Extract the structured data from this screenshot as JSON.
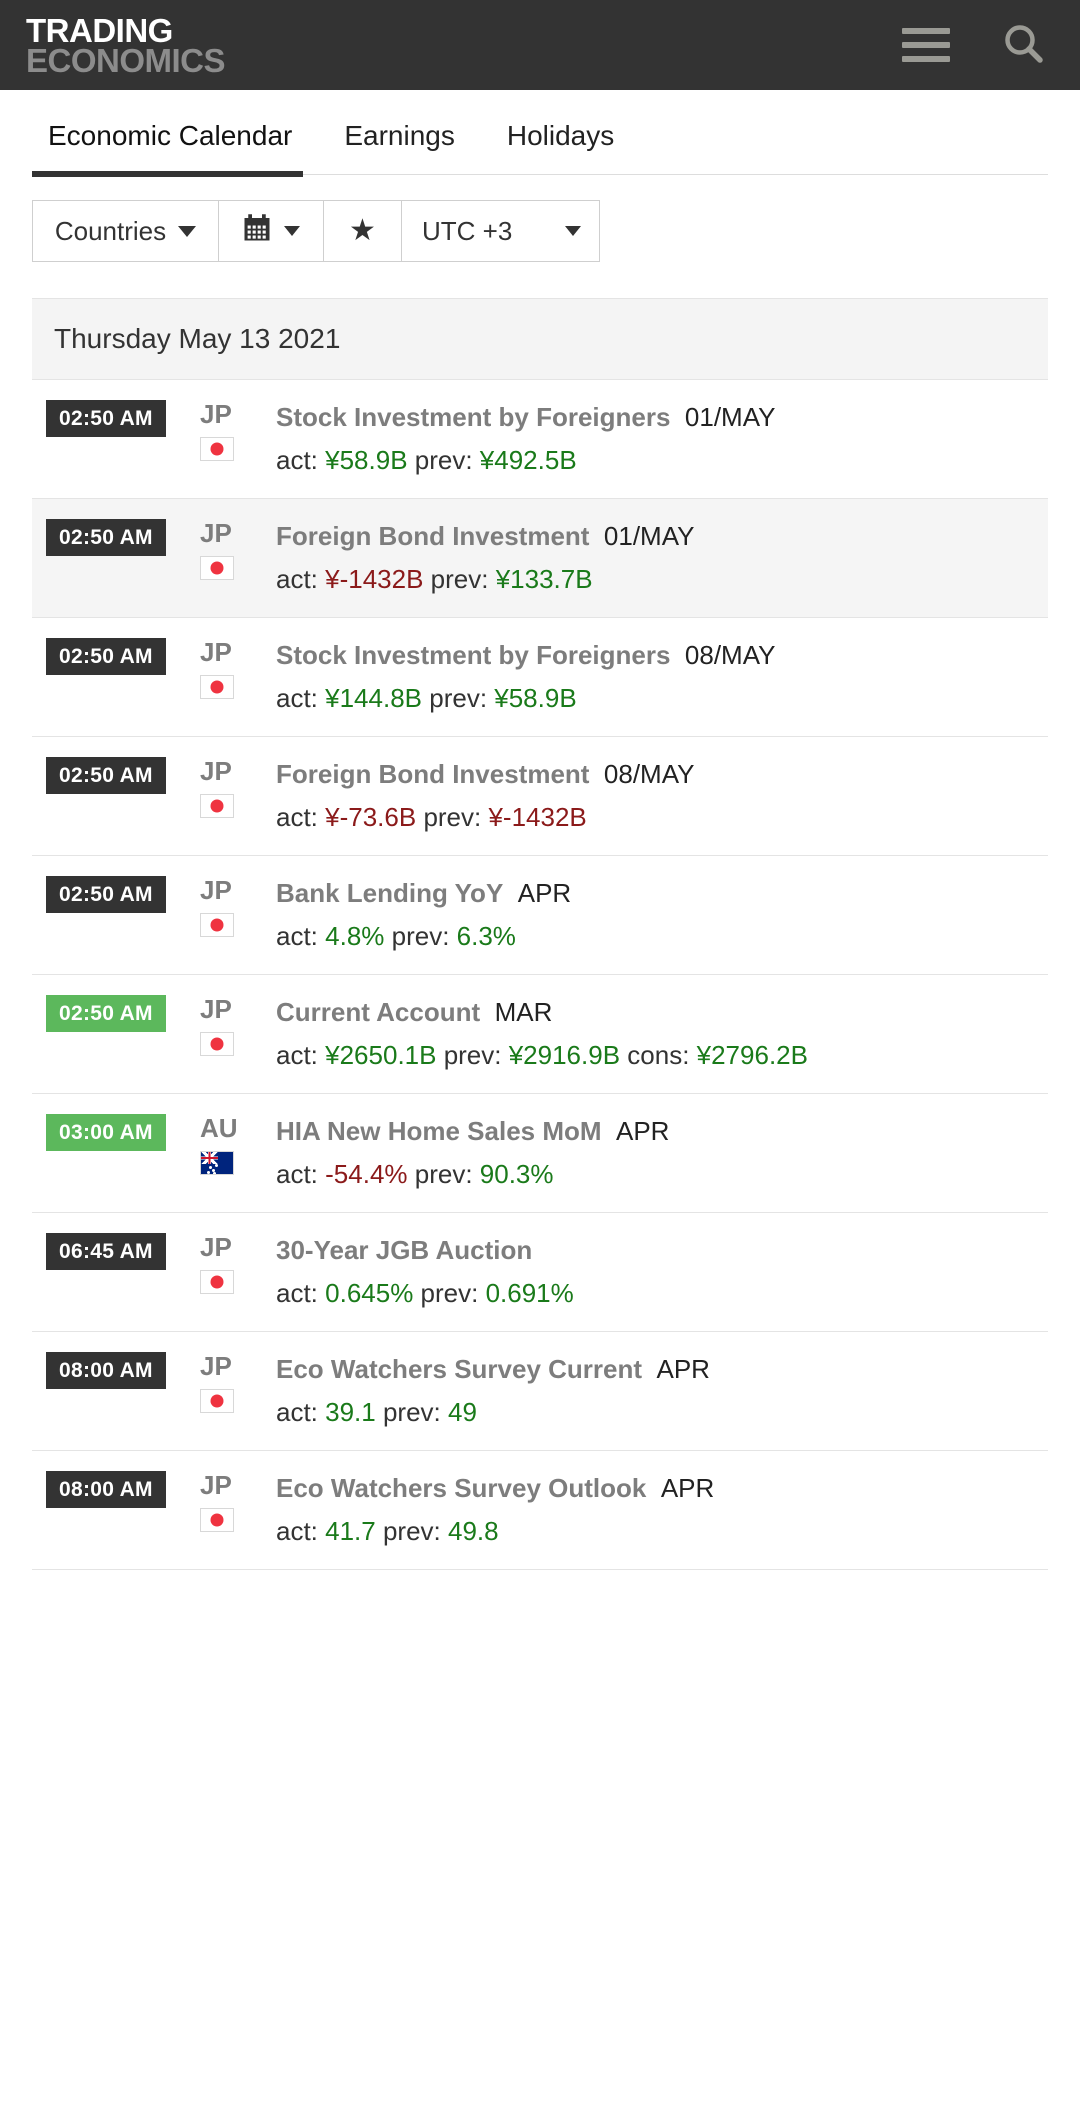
{
  "header": {
    "brand_top": "TRADING",
    "brand_bottom": "ECONOMICS",
    "menu_icon": "hamburger-icon",
    "search_icon": "search-icon",
    "background_color": "#333333"
  },
  "tabs": [
    {
      "label": "Economic Calendar",
      "active": true
    },
    {
      "label": "Earnings",
      "active": false
    },
    {
      "label": "Holidays",
      "active": false
    }
  ],
  "filters": {
    "countries_label": "Countries",
    "calendar_icon": "calendar-icon",
    "star_icon": "star-icon",
    "timezone_value": "UTC +3"
  },
  "calendar": {
    "date_header": "Thursday May 13 2021",
    "labels": {
      "actual": "act:",
      "previous": "prev:",
      "consensus": "cons:"
    },
    "colors": {
      "badge_default": "#333333",
      "badge_highlight": "#5cb85c",
      "positive": "#1a7a1a",
      "negative": "#8b1a1a"
    },
    "events": [
      {
        "time": "02:50 AM",
        "time_highlight": false,
        "country": "JP",
        "flag": "jp-flag",
        "title": "Stock Investment by Foreigners",
        "reference": "01/MAY",
        "actual": "¥58.9B",
        "actual_sign": "pos",
        "previous": "¥492.5B",
        "previous_sign": "pos",
        "consensus": "",
        "consensus_sign": "",
        "alt": false
      },
      {
        "time": "02:50 AM",
        "time_highlight": false,
        "country": "JP",
        "flag": "jp-flag",
        "title": "Foreign Bond Investment",
        "reference": "01/MAY",
        "actual": "¥-1432B",
        "actual_sign": "neg",
        "previous": "¥133.7B",
        "previous_sign": "pos",
        "consensus": "",
        "consensus_sign": "",
        "alt": true
      },
      {
        "time": "02:50 AM",
        "time_highlight": false,
        "country": "JP",
        "flag": "jp-flag",
        "title": "Stock Investment by Foreigners",
        "reference": "08/MAY",
        "actual": "¥144.8B",
        "actual_sign": "pos",
        "previous": "¥58.9B",
        "previous_sign": "pos",
        "consensus": "",
        "consensus_sign": "",
        "alt": false
      },
      {
        "time": "02:50 AM",
        "time_highlight": false,
        "country": "JP",
        "flag": "jp-flag",
        "title": "Foreign Bond Investment",
        "reference": "08/MAY",
        "actual": "¥-73.6B",
        "actual_sign": "neg",
        "previous": "¥-1432B",
        "previous_sign": "neg",
        "consensus": "",
        "consensus_sign": "",
        "alt": false
      },
      {
        "time": "02:50 AM",
        "time_highlight": false,
        "country": "JP",
        "flag": "jp-flag",
        "title": "Bank Lending YoY",
        "reference": "APR",
        "actual": "4.8%",
        "actual_sign": "pos",
        "previous": "6.3%",
        "previous_sign": "pos",
        "consensus": "",
        "consensus_sign": "",
        "alt": false
      },
      {
        "time": "02:50 AM",
        "time_highlight": true,
        "country": "JP",
        "flag": "jp-flag",
        "title": "Current Account",
        "reference": "MAR",
        "actual": "¥2650.1B",
        "actual_sign": "pos",
        "previous": "¥2916.9B",
        "previous_sign": "pos",
        "consensus": "¥2796.2B",
        "consensus_sign": "pos",
        "alt": false
      },
      {
        "time": "03:00 AM",
        "time_highlight": true,
        "country": "AU",
        "flag": "au-flag",
        "title": "HIA New Home Sales MoM",
        "reference": "APR",
        "actual": "-54.4%",
        "actual_sign": "neg",
        "previous": "90.3%",
        "previous_sign": "pos",
        "consensus": "",
        "consensus_sign": "",
        "alt": false
      },
      {
        "time": "06:45 AM",
        "time_highlight": false,
        "country": "JP",
        "flag": "jp-flag",
        "title": "30-Year JGB Auction",
        "reference": "",
        "actual": "0.645%",
        "actual_sign": "pos",
        "previous": "0.691%",
        "previous_sign": "pos",
        "consensus": "",
        "consensus_sign": "",
        "alt": false
      },
      {
        "time": "08:00 AM",
        "time_highlight": false,
        "country": "JP",
        "flag": "jp-flag",
        "title": "Eco Watchers Survey Current",
        "reference": "APR",
        "actual": "39.1",
        "actual_sign": "pos",
        "previous": "49",
        "previous_sign": "pos",
        "consensus": "",
        "consensus_sign": "",
        "alt": false
      },
      {
        "time": "08:00 AM",
        "time_highlight": false,
        "country": "JP",
        "flag": "jp-flag",
        "title": "Eco Watchers Survey Outlook",
        "reference": "APR",
        "actual": "41.7",
        "actual_sign": "pos",
        "previous": "49.8",
        "previous_sign": "pos",
        "consensus": "",
        "consensus_sign": "",
        "alt": false
      }
    ]
  }
}
